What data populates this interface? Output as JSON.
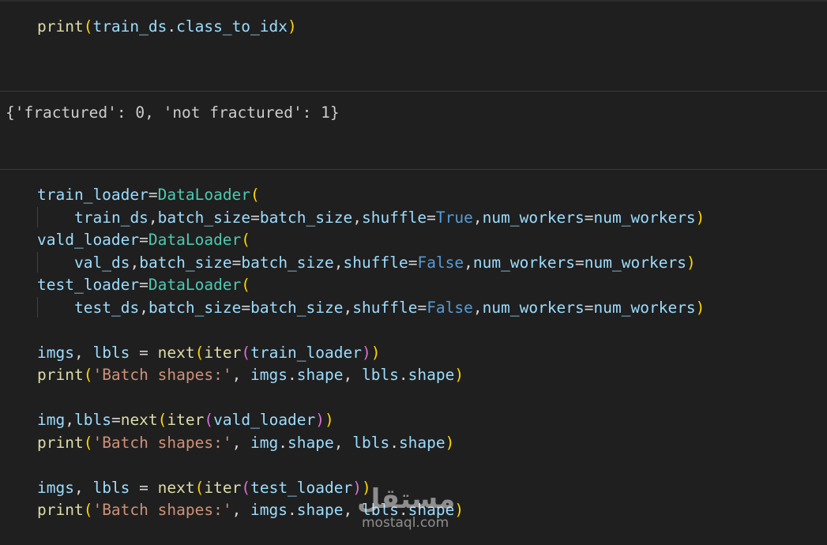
{
  "cells": {
    "print_class_to_idx": {
      "print": "print",
      "p_open": "(",
      "arg_obj": "train_ds",
      "dot": ".",
      "arg_attr": "class_to_idx",
      "p_close": ")"
    },
    "output_class_to_idx": "{'fractured': 0, 'not fractured': 1}",
    "loaders": {
      "train": {
        "name": "train_loader",
        "eq": "=",
        "cls": "DataLoader",
        "open": "(",
        "ds": "train_ds",
        "bs_kw": "batch_size",
        "bs_val": "batch_size",
        "sh_kw": "shuffle",
        "sh_val": "True",
        "nw_kw": "num_workers",
        "nw_val": "num_workers",
        "close": ")"
      },
      "vald": {
        "name": "vald_loader",
        "eq": "=",
        "cls": "DataLoader",
        "open": "(",
        "ds": "val_ds",
        "bs_kw": "batch_size",
        "bs_val": "batch_size",
        "sh_kw": "shuffle",
        "sh_val": "False",
        "nw_kw": "num_workers",
        "nw_val": "num_workers",
        "close": ")"
      },
      "test": {
        "name": "test_loader",
        "eq": "=",
        "cls": "DataLoader",
        "open": "(",
        "ds": "test_ds",
        "bs_kw": "batch_size",
        "bs_val": "batch_size",
        "sh_kw": "shuffle",
        "sh_val": "False",
        "nw_kw": "num_workers",
        "nw_val": "num_workers",
        "close": ")"
      }
    },
    "batches": [
      {
        "v1": "imgs",
        "sep": ", ",
        "v2": "lbls",
        "assign": " = ",
        "next": "next",
        "iter": "iter",
        "loader": "train_loader",
        "print": "print",
        "label": "'Batch shapes:'",
        "sv1": "imgs",
        "sv2": "lbls",
        "shape": "shape"
      },
      {
        "v1": "img",
        "sep": ",",
        "v2": "lbls",
        "assign": "=",
        "next": "next",
        "iter": "iter",
        "loader": "vald_loader",
        "print": "print",
        "label": "'Batch shapes:'",
        "sv1": "img",
        "sv2": "lbls",
        "shape": "shape"
      },
      {
        "v1": "imgs",
        "sep": ", ",
        "v2": "lbls",
        "assign": " = ",
        "next": "next",
        "iter": "iter",
        "loader": "test_loader",
        "print": "print",
        "label": "'Batch shapes:'",
        "sv1": "imgs",
        "sv2": "lbls",
        "shape": "shape"
      }
    ]
  },
  "watermark": {
    "arabic": "مستقل",
    "latin": "mostaql.com"
  },
  "colors": {
    "background": "#1f1f1f",
    "function": "#dcdcaa",
    "variable": "#9cdcfe",
    "class": "#4ec9b0",
    "keyword": "#569cd6",
    "string": "#ce9178",
    "bracket1": "#ffd700",
    "bracket2": "#da70d6",
    "bracket3": "#179fff"
  }
}
